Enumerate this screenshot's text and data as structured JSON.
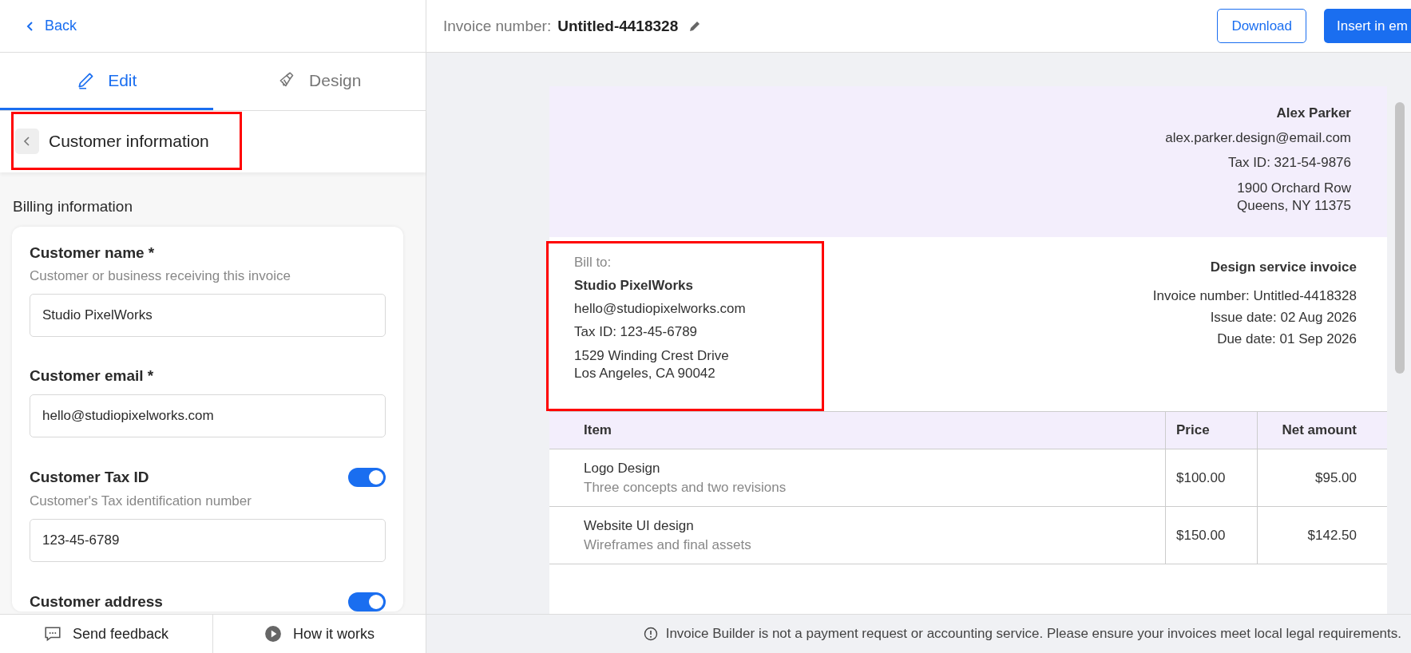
{
  "back_link": "Back",
  "tabs": [
    {
      "label": "Edit",
      "kind": "pencil",
      "selected": true
    },
    {
      "label": "Design",
      "kind": "brush",
      "selected": false
    }
  ],
  "section_header": {
    "title": "Customer information",
    "highlighted": true
  },
  "group_title": "Billing information",
  "fields": [
    {
      "kind": "text",
      "label": "Customer name *",
      "hint": "Customer or business receiving this invoice",
      "value": "Studio PixelWorks"
    },
    {
      "kind": "text",
      "label": "Customer email *",
      "value": "hello@studiopixelworks.com"
    },
    {
      "kind": "toggle",
      "label": "Customer Tax ID",
      "on": true,
      "hint": "Customer's Tax identification number",
      "value": "123-45-6789"
    },
    {
      "kind": "toggle",
      "label": "Customer address",
      "on": true
    }
  ],
  "bottom_buttons": [
    {
      "label": "Send feedback",
      "kind": "feedback"
    },
    {
      "label": "How it works",
      "kind": "help"
    }
  ],
  "top_bar": {
    "label": "Invoice number:",
    "value": "Untitled-4418328",
    "buttons": [
      {
        "label": "Download",
        "kind": "outline"
      },
      {
        "label": "Insert in em",
        "kind": "primary"
      }
    ]
  },
  "invoice": {
    "sender": {
      "name": "Alex Parker",
      "email": "alex.parker.design@email.com",
      "tax_id": "Tax ID: 321-54-9876",
      "address": [
        "1900 Orchard Row",
        "Queens, NY 11375"
      ]
    },
    "bill_to": {
      "highlighted": true,
      "label": "Bill to:",
      "name": "Studio PixelWorks",
      "email": "hello@studiopixelworks.com",
      "tax_id": "Tax ID: 123-45-6789",
      "address": [
        "1529 Winding Crest Drive",
        "Los Angeles, CA 90042"
      ]
    },
    "details": {
      "title": "Design service invoice",
      "lines": [
        "Invoice number: Untitled-4418328",
        "Issue date: 02 Aug 2026",
        "Due date: 01 Sep 2026"
      ]
    },
    "table": {
      "columns": [
        "Item",
        "Price",
        "Net amount"
      ],
      "rows": [
        {
          "item": "Logo Design",
          "description": "Three concepts and two revisions",
          "price": "$100.00",
          "net": "$95.00"
        },
        {
          "item": "Website UI design",
          "description": "Wireframes and final assets",
          "price": "$150.00",
          "net": "$142.50"
        }
      ]
    }
  },
  "notice": "Invoice Builder is not a payment request or accounting service. Please ensure your invoices meet local legal requirements."
}
